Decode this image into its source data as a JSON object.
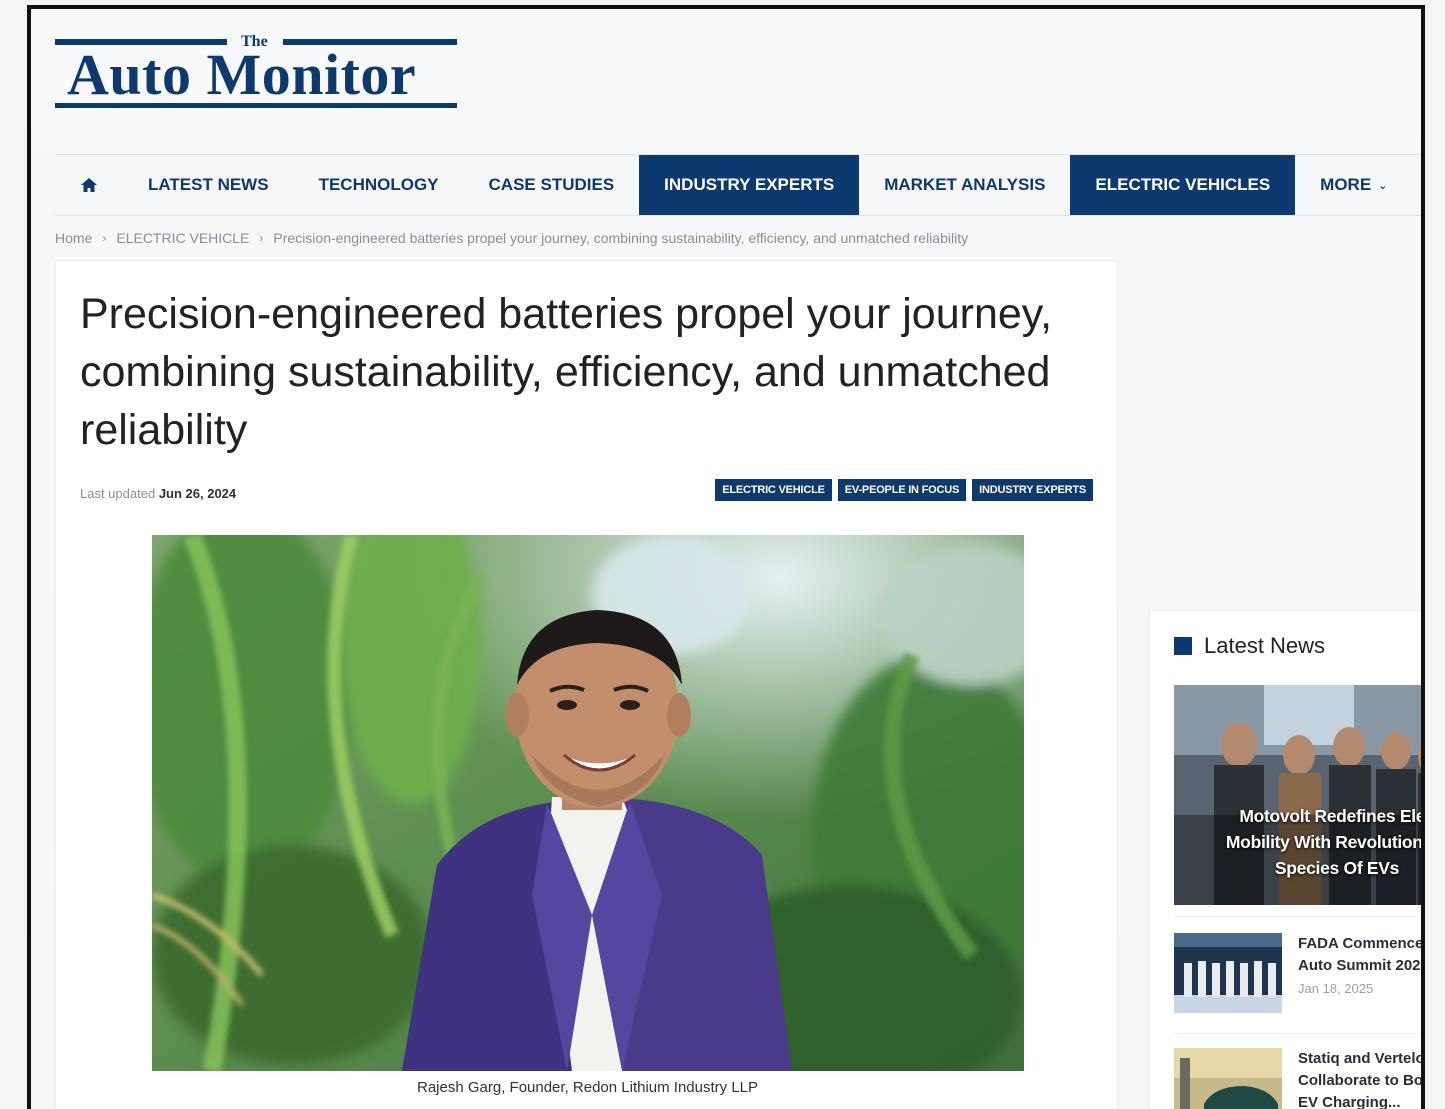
{
  "logo": {
    "the": "The",
    "name": "Auto Monitor"
  },
  "nav": {
    "items": [
      {
        "label": "LATEST NEWS"
      },
      {
        "label": "TECHNOLOGY"
      },
      {
        "label": "CASE STUDIES"
      },
      {
        "label": "INDUSTRY EXPERTS"
      },
      {
        "label": "MARKET ANALYSIS"
      },
      {
        "label": "ELECTRIC VEHICLES"
      },
      {
        "label": "MORE"
      }
    ]
  },
  "breadcrumb": {
    "home": "Home",
    "category": "ELECTRIC VEHICLE",
    "current": "Precision-engineered batteries propel your journey, combining sustainability, efficiency, and unmatched reliability"
  },
  "article": {
    "title": "Precision-engineered batteries propel your journey, combining sustainability, efficiency, and unmatched reliability",
    "updated_label": "Last updated",
    "updated_date": "Jun 26, 2024",
    "tags": [
      "ELECTRIC VEHICLE",
      "EV-PEOPLE IN FOCUS",
      "INDUSTRY EXPERTS"
    ],
    "caption": "Rajesh Garg, Founder, Redon Lithium Industry LLP"
  },
  "sidebar": {
    "heading": "Latest News",
    "featured": {
      "line1": "Motovolt Redefines Elec",
      "line2": "Mobility With Revolutionary",
      "line3": "Species Of EVs"
    },
    "items": [
      {
        "line1": "FADA Commence",
        "line2": "Auto Summit 202",
        "date": "Jan 18, 2025"
      },
      {
        "line1": "Statiq and Vertelo",
        "line2": "Collaborate to Bo",
        "line3": "EV Charging..."
      }
    ]
  },
  "colors": {
    "brand": "#0d3a6e",
    "text": "#222222",
    "muted": "#8a8f96"
  }
}
